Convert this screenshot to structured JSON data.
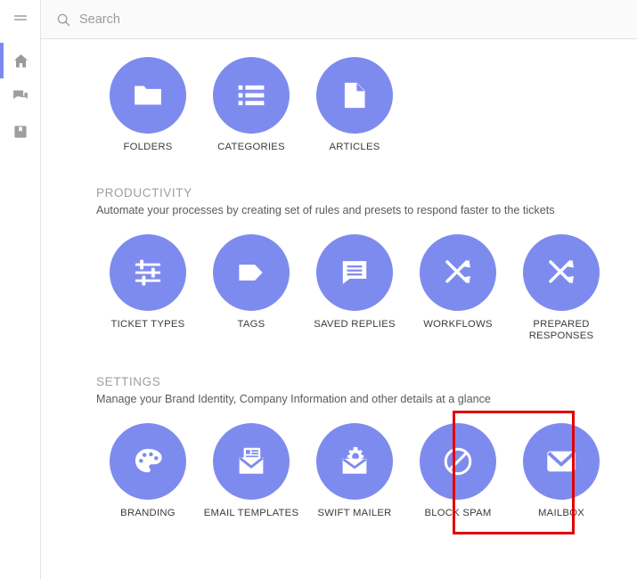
{
  "colors": {
    "accent_purple": "#7e8bee",
    "rail_active_bar": "#7b89ef",
    "highlight_red": "#e00000",
    "topbar_bg": "#fafafa",
    "label_text": "#3b3b3b",
    "section_title": "#9e9e9e"
  },
  "rail": {
    "items": [
      {
        "name": "menu-toggle",
        "icon": "hamburger-icon",
        "active": false
      },
      {
        "name": "home",
        "icon": "home-icon",
        "active": true
      },
      {
        "name": "conversations",
        "icon": "chat-icon",
        "active": false
      },
      {
        "name": "bookmarks",
        "icon": "bookmark-icon",
        "active": false
      }
    ]
  },
  "search": {
    "icon": "search-icon",
    "placeholder": "Search",
    "value": ""
  },
  "sections": [
    {
      "id": "knowledge-base",
      "title": "",
      "subtitle": "",
      "tiles": [
        {
          "label": "FOLDERS",
          "icon": "folder-icon"
        },
        {
          "label": "CATEGORIES",
          "icon": "list-icon"
        },
        {
          "label": "ARTICLES",
          "icon": "document-icon"
        }
      ]
    },
    {
      "id": "productivity",
      "title": "PRODUCTIVITY",
      "subtitle": "Automate your processes by creating set of rules and presets to respond faster to the tickets",
      "tiles": [
        {
          "label": "TICKET TYPES",
          "icon": "sliders-icon"
        },
        {
          "label": "TAGS",
          "icon": "tag-icon"
        },
        {
          "label": "SAVED REPLIES",
          "icon": "chat-lines-icon"
        },
        {
          "label": "WORKFLOWS",
          "icon": "shuffle-icon"
        },
        {
          "label": "PREPARED RESPONSES",
          "icon": "shuffle-icon"
        }
      ]
    },
    {
      "id": "settings",
      "title": "SETTINGS",
      "subtitle": "Manage your Brand Identity, Company Information and other details at a glance",
      "tiles": [
        {
          "label": "BRANDING",
          "icon": "palette-icon"
        },
        {
          "label": "EMAIL TEMPLATES",
          "icon": "envelope-card-icon"
        },
        {
          "label": "SWIFT MAILER",
          "icon": "envelope-gear-icon"
        },
        {
          "label": "BLOCK SPAM",
          "icon": "block-icon"
        },
        {
          "label": "MAILBOX",
          "icon": "envelope-icon"
        }
      ]
    }
  ],
  "highlight": {
    "target_label": "MAILBOX",
    "color": "#e00000"
  }
}
